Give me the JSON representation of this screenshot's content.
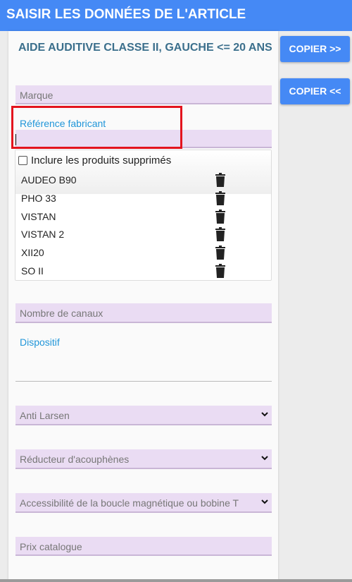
{
  "header": {
    "title": "SAISIR LES DONNÉES DE L'ARTICLE"
  },
  "subtitle": "AIDE AUDITIVE CLASSE II, GAUCHE <= 20 ANS",
  "side_buttons": {
    "copy_right": "COPIER >>",
    "copy_left": "COPIER <<"
  },
  "form": {
    "marque": "Marque",
    "reference": "Référence fabricant",
    "include_deleted": "Inclure les produits supprimés",
    "products": [
      "AUDEO B90",
      "PHO 33",
      "VISTAN",
      "VISTAN 2",
      "XII20",
      "SO II"
    ],
    "canaux": "Nombre de canaux",
    "dispositif": "Dispositif",
    "anti_larsen": "Anti Larsen",
    "reducteur": "Réducteur d'acouphènes",
    "boucle": "Accessibilité de la boucle magnétique ou bobine T",
    "prix": "Prix catalogue"
  },
  "icons": {
    "trash": "trash-icon",
    "chevron": "chevron-down-icon"
  },
  "colors": {
    "header_bg": "#4589f5",
    "field_bg": "#eadcf3",
    "label_blue": "#2196d9",
    "highlight": "#e3141e"
  }
}
